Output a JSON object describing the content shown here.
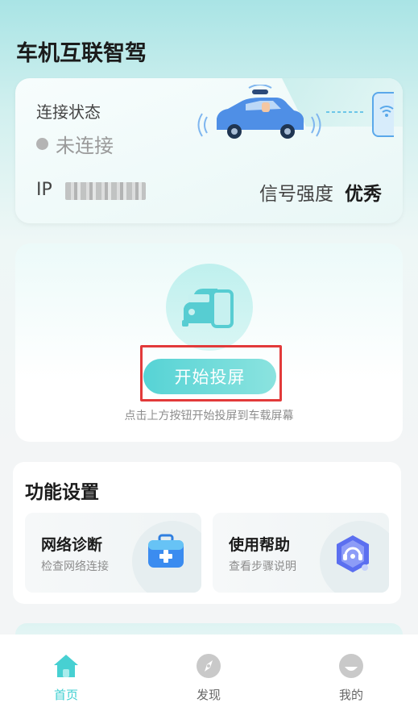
{
  "header": {
    "title": "车机互联智驾"
  },
  "status": {
    "connection_label": "连接状态",
    "connection_state": "未连接",
    "ip_label": "IP",
    "signal_label": "信号强度",
    "signal_value": "优秀"
  },
  "projection": {
    "button_label": "开始投屏",
    "hint": "点击上方按钮开始投屏到车载屏幕"
  },
  "functions": {
    "title": "功能设置",
    "items": [
      {
        "title": "网络诊断",
        "subtitle": "检查网络连接",
        "icon": "medical-kit-icon"
      },
      {
        "title": "使用帮助",
        "subtitle": "查看步骤说明",
        "icon": "headset-support-icon"
      }
    ]
  },
  "tabbar": {
    "items": [
      {
        "label": "首页",
        "icon": "home-icon",
        "active": true
      },
      {
        "label": "发现",
        "icon": "compass-icon",
        "active": false
      },
      {
        "label": "我的",
        "icon": "profile-icon",
        "active": false
      }
    ]
  },
  "colors": {
    "accent": "#3ecfd1",
    "button_gradient_start": "#56d3d5",
    "button_gradient_end": "#8be3df",
    "highlight_border": "#e23a3a"
  }
}
